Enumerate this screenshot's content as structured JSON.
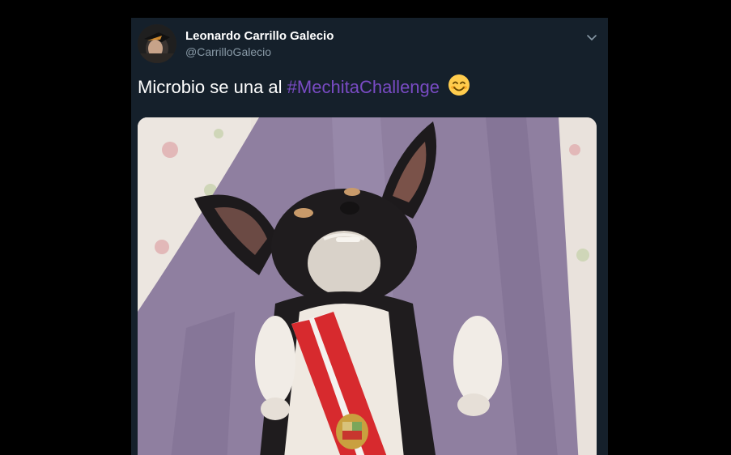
{
  "tweet": {
    "author_name": "Leonardo Carrillo Galecio",
    "author_handle": "@CarrilloGalecio",
    "text": "Microbio se una al",
    "hashtag": "#MechitaChallenge",
    "emoji": "smiling-face-with-smiling-eyes",
    "menu_icon": "chevron-down-icon",
    "media_alt": "dog-with-peru-presidential-sash-photo"
  },
  "colors": {
    "background": "#000000",
    "card": "#15202b",
    "text_primary": "#ffffff",
    "text_secondary": "#8899a6",
    "hashtag": "#794bc4"
  }
}
